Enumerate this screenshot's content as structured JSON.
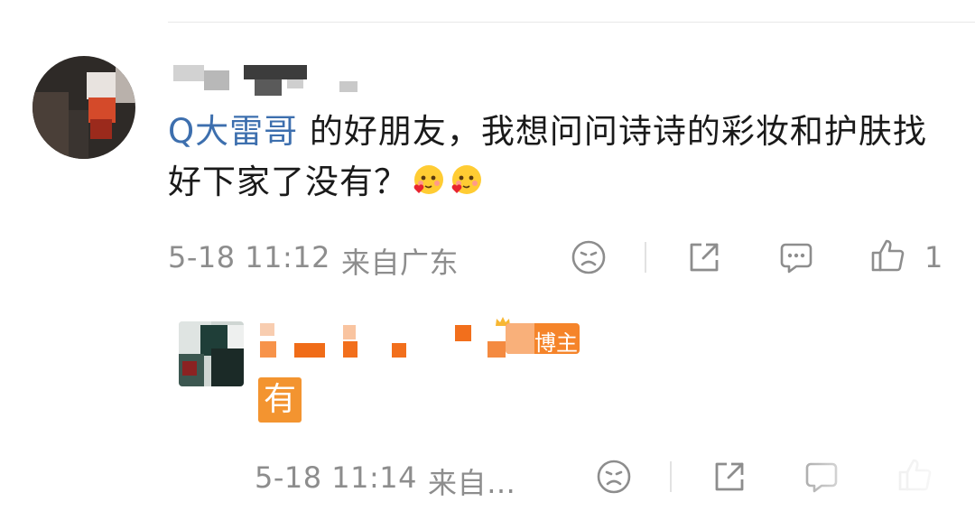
{
  "comment": {
    "mention": "Q大雷哥",
    "text": " 的好朋友，我想问问诗诗的彩妆和护肤找好下家了没有？",
    "emojis": [
      "blush-heart-emoji",
      "blush-heart-emoji"
    ],
    "time": "5-18 11:12",
    "location": "来自广东",
    "like_count": "1"
  },
  "reply": {
    "author_badge": "博主",
    "text": "有",
    "time": "5-18 11:14",
    "location": "来自…"
  },
  "icons": {
    "dislike": "sad-face-icon",
    "share": "share-icon",
    "comment": "comment-icon",
    "like": "thumbs-up-icon"
  },
  "colors": {
    "mention": "#3d6fae",
    "badge": "#f5842a",
    "meta_text": "#8d8d8d"
  }
}
